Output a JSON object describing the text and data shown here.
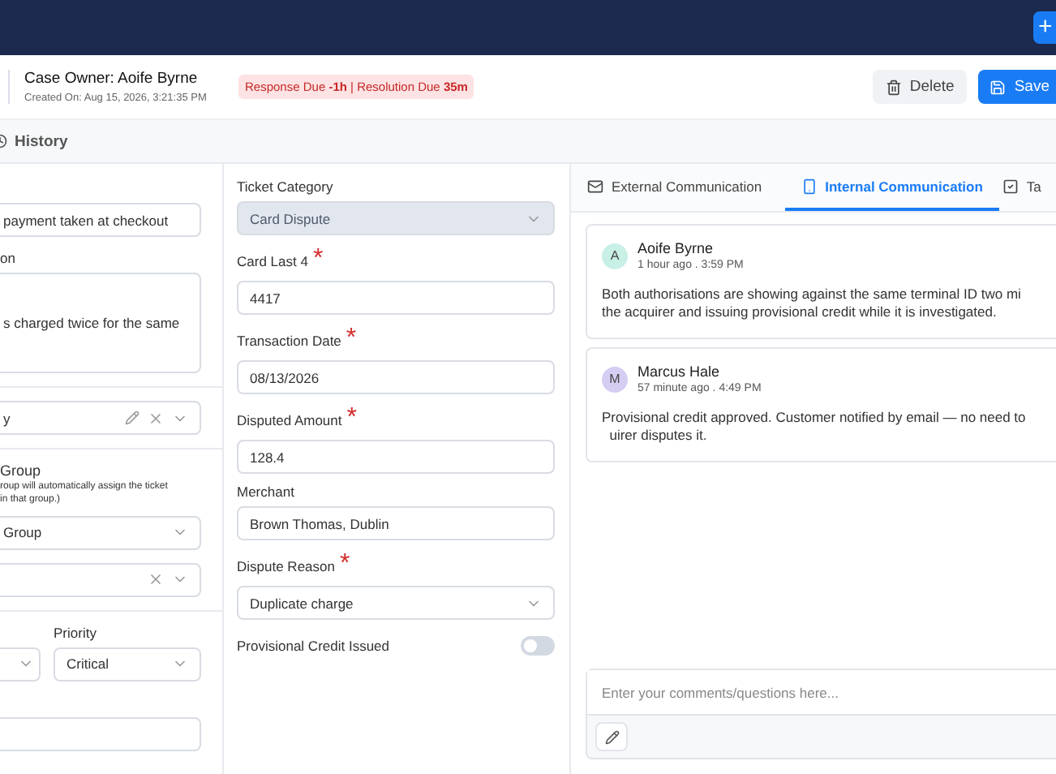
{
  "topbar": {
    "add_label": "+"
  },
  "header": {
    "owner": "Case Owner: Aoife Byrne",
    "created": "Created On: Aug 15, 2026, 3:21:35 PM",
    "sla": "Response Due **-1h** | Resolution Due **35m**",
    "actions": [
      {
        "label": "Delete",
        "kind": "secondary"
      },
      {
        "label": "Save",
        "kind": "primary"
      }
    ]
  },
  "history_tab": "History",
  "left_fields": [
    {
      "kind": "input",
      "value": "payment taken at checkout"
    },
    {
      "kind": "textarea",
      "label": "on",
      "value": "s charged twice for the same"
    },
    {
      "kind": "divider"
    },
    {
      "kind": "select",
      "value": "y",
      "editable": true,
      "clearable": true
    },
    {
      "kind": "divider"
    },
    {
      "kind": "select",
      "label": "Group",
      "hint": "roup will automatically assign the ticket\nin that group.)",
      "value": "Group",
      "editable": false,
      "clearable": false
    },
    {
      "kind": "select",
      "editable": false,
      "clearable": true
    },
    {
      "kind": "divider"
    },
    {
      "kind": "pair",
      "label": "Priority",
      "value": "Critical"
    },
    {
      "kind": "stub"
    }
  ],
  "middle_fields": [
    {
      "kind": "select",
      "label": "Ticket Category",
      "value": "Card Dispute",
      "disabled": true
    },
    {
      "kind": "input",
      "label": "Card Last 4",
      "required_mark": "*",
      "value": "4417",
      "disabled": false
    },
    {
      "kind": "input",
      "label": "Transaction Date",
      "required_mark": "*",
      "value": "08/13/2026",
      "disabled": false
    },
    {
      "kind": "input",
      "label": "Disputed Amount",
      "required_mark": "*",
      "value": "128.4",
      "disabled": false
    },
    {
      "kind": "input",
      "label": "Merchant",
      "value": "Brown Thomas, Dublin",
      "disabled": false
    },
    {
      "kind": "select",
      "label": "Dispute Reason",
      "required_mark": "*",
      "value": "Duplicate charge",
      "disabled": false
    },
    {
      "kind": "toggle",
      "label": "Provisional Credit Issued",
      "on": false
    }
  ],
  "tabs": [
    {
      "label": "External Communication",
      "kind": "mail",
      "selected": false
    },
    {
      "label": "Internal Communication",
      "kind": "phone",
      "selected": true
    },
    {
      "label": "Ta",
      "kind": "task",
      "selected": false
    }
  ],
  "messages": [
    {
      "initial": "A",
      "color": "#c9f0e6",
      "name": "Aoife Byrne",
      "time": "1 hour ago . 3:59 PM",
      "body": "Both authorisations are showing against the same terminal ID two mi\nthe acquirer and issuing provisional credit while it is investigated."
    },
    {
      "initial": "M",
      "color": "#d6cdf3",
      "name": "Marcus Hale",
      "time": "57 minute ago . 4:49 PM",
      "body": "Provisional credit approved. Customer notified by email — no need to\n  uirer disputes it."
    }
  ],
  "comment": {
    "placeholder": "Enter your comments/questions here..."
  }
}
